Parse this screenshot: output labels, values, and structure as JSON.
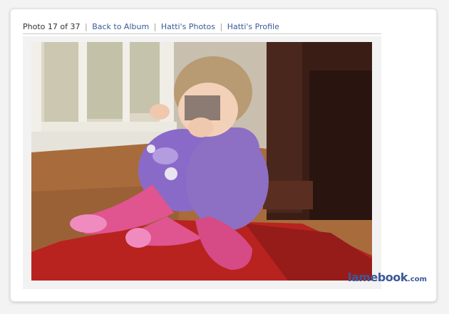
{
  "nav": {
    "photo_counter": "Photo 17 of 37",
    "back_link": "Back to Album",
    "photos_link": "Hatti's Photos",
    "profile_link": "Hatti's Profile",
    "separator": "|"
  },
  "watermark": {
    "brand": "lamebook",
    "suffix": ".com"
  },
  "colors": {
    "link": "#3b5998",
    "wall": "#d9d2c4",
    "floor": "#a86c3c",
    "rug": "#b8231f",
    "shirt": "#8d6fc4",
    "balloon": "#8a6ac9",
    "leggings": "#e0548f",
    "sofa": "#3a1e16"
  }
}
